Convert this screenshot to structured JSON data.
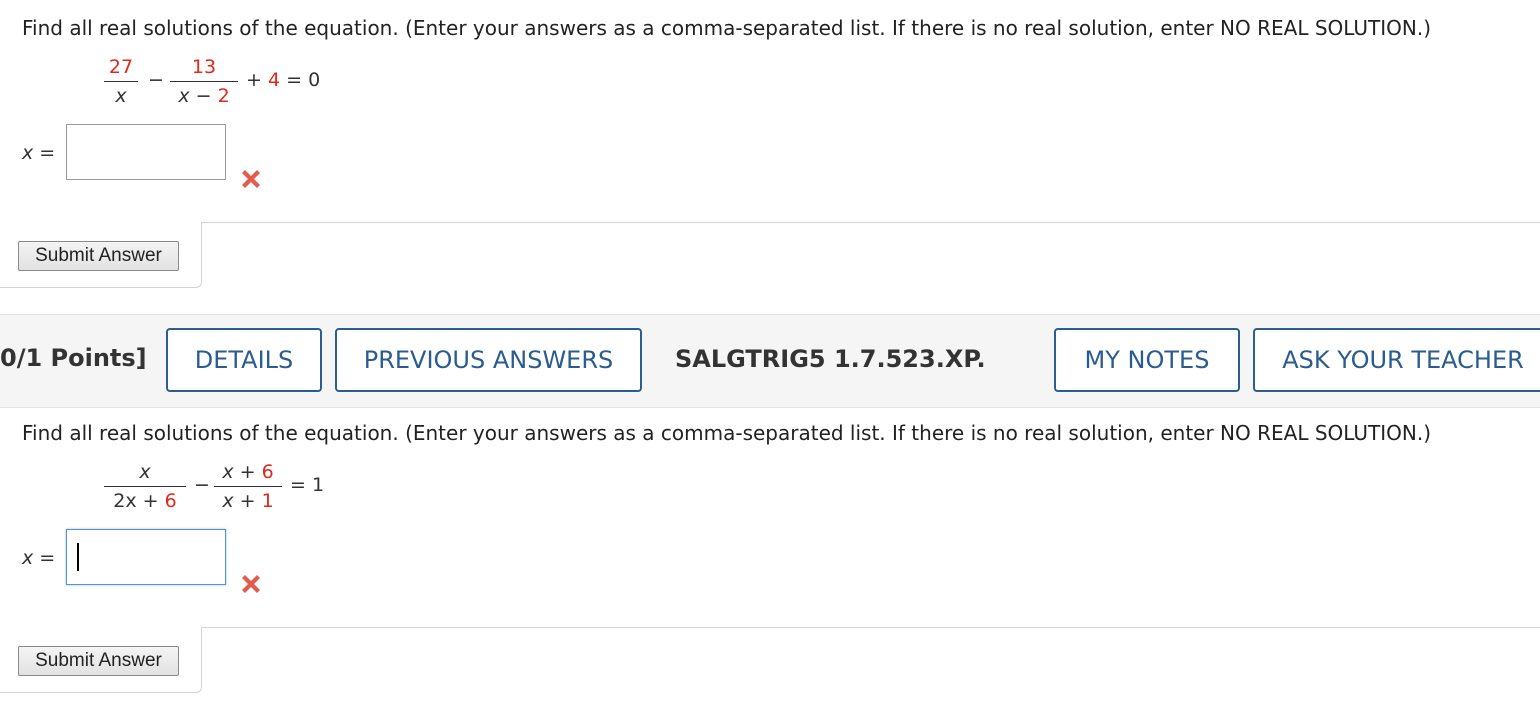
{
  "problem1": {
    "prompt": "Find all real solutions of the equation. (Enter your answers as a comma-separated list. If there is no real solution, enter NO REAL SOLUTION.)",
    "equation": {
      "frac1_num": "27",
      "frac1_den": "x",
      "minus": "−",
      "frac2_num": "13",
      "frac2_den_var": "x",
      "frac2_den_op": "−",
      "frac2_den_const": "2",
      "tail_plus": "+",
      "tail_const": "4",
      "tail_eq": "= 0"
    },
    "answer_label_var": "x",
    "answer_label_eq": "=",
    "answer_value": "",
    "status_icon": "incorrect-x-icon",
    "submit_label": "Submit Answer"
  },
  "header": {
    "points": "0/1 Points]",
    "details": "DETAILS",
    "previous_answers": "PREVIOUS ANSWERS",
    "code": "SALGTRIG5 1.7.523.XP.",
    "my_notes": "MY NOTES",
    "ask_teacher": "ASK YOUR TEACHER",
    "button_border_color": "#2b5d8f"
  },
  "problem2": {
    "prompt": "Find all real solutions of the equation. (Enter your answers as a comma-separated list. If there is no real solution, enter NO REAL SOLUTION.)",
    "equation": {
      "frac1_num": "x",
      "frac1_den_coef": "2x",
      "frac1_den_op": "+",
      "frac1_den_const": "6",
      "minus": "−",
      "frac2_num_var": "x",
      "frac2_num_op": "+",
      "frac2_num_const": "6",
      "frac2_den_var": "x",
      "frac2_den_op": "+",
      "frac2_den_const": "1",
      "tail_eq": "= 1"
    },
    "answer_label_var": "x",
    "answer_label_eq": "=",
    "answer_value": "",
    "status_icon": "incorrect-x-icon",
    "submit_label": "Submit Answer"
  },
  "colors": {
    "highlight": "#e0291c",
    "link": "#2a5c90",
    "error_x": "#e55a4e"
  }
}
